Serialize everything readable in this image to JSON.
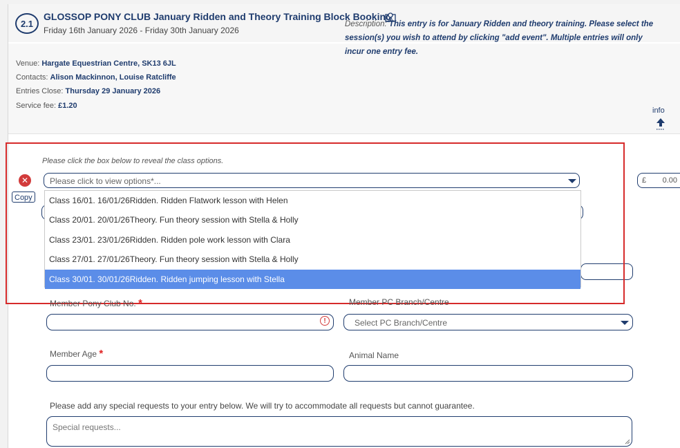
{
  "event": {
    "number": "2.1",
    "title": "GLOSSOP PONY CLUB January Ridden and Theory Training Block Booking",
    "dates": "Friday 16th January 2026 - Friday 30th January 2026"
  },
  "info": {
    "venue_label": "Venue: ",
    "venue": "Hargate Equestrian Centre, SK13 6JL",
    "contacts_label": "Contacts: ",
    "contacts": "Alison Mackinnon, Louise Ratcliffe",
    "close_label": "Entries Close: ",
    "close": "Thursday 29 January 2026",
    "fee_label": "Service fee: ",
    "fee": "£1.20",
    "desc_label": "Description: ",
    "description": "This entry is for January Ridden and theory training. Please select the session(s) you wish to attend by clicking \"add event\". Multiple entries will only incur one entry fee.",
    "info_link": "info"
  },
  "class_select": {
    "hint": "Please click the box below to reveal the class options.",
    "placeholder": "Please click to view options*...",
    "copy_label": "Copy",
    "currency": "£",
    "price": "0.00",
    "options": [
      "Class 16/01. 16/01/26Ridden. Ridden Flatwork lesson with Helen",
      "Class 20/01. 20/01/26Theory. Fun theory session with Stella & Holly",
      "Class 23/01. 23/01/26Ridden. Ridden pole work lesson with Clara",
      "Class 27/01. 27/01/26Theory. Fun theory session with Stella & Holly",
      "Class 30/01. 30/01/26Ridden. Ridden jumping lesson with Stella"
    ],
    "highlighted_index": 4
  },
  "form": {
    "member_no_label": "Member Pony Club No.",
    "branch_label": "Member PC Branch/Centre",
    "branch_placeholder": "Select PC Branch/Centre",
    "age_label": "Member Age",
    "animal_label": "Animal Name",
    "required_mark": "*",
    "warn_glyph": "!",
    "note": "Please add any special requests to your entry below. We will try to accommodate all requests but cannot guarantee.",
    "requests_placeholder": "Special requests..."
  },
  "colors": {
    "navy": "#1f3c6e",
    "error_red": "#d23b3b",
    "highlight": "#5b8de8",
    "frame_red": "#d62a2a"
  }
}
